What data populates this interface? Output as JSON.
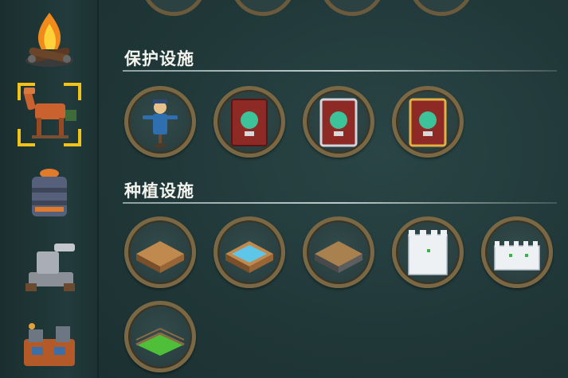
{
  "sections": {
    "protection": {
      "title": "保护设施"
    },
    "planting": {
      "title": "种植设施"
    }
  },
  "sidebar": {
    "items": [
      {
        "icon": "campfire-icon"
      },
      {
        "icon": "horse-rack-icon",
        "selected": true
      },
      {
        "icon": "silo-icon"
      },
      {
        "icon": "workbench-icon"
      },
      {
        "icon": "factory-icon"
      }
    ]
  },
  "protection_items": [
    {
      "icon": "scarecrow-icon"
    },
    {
      "icon": "red-warning-sign-icon"
    },
    {
      "icon": "silver-warning-sign-icon"
    },
    {
      "icon": "gold-warning-sign-icon"
    }
  ],
  "planting_items": [
    {
      "icon": "wood-farmland-icon"
    },
    {
      "icon": "water-pool-icon"
    },
    {
      "icon": "stone-farmland-icon"
    },
    {
      "icon": "white-fence-corner-icon"
    },
    {
      "icon": "white-fence-wall-icon"
    },
    {
      "icon": "grass-fence-pen-icon"
    }
  ],
  "colors": {
    "selection": "#f3c21a",
    "slot_ring": "#7a6845",
    "background": "#1e3536"
  }
}
